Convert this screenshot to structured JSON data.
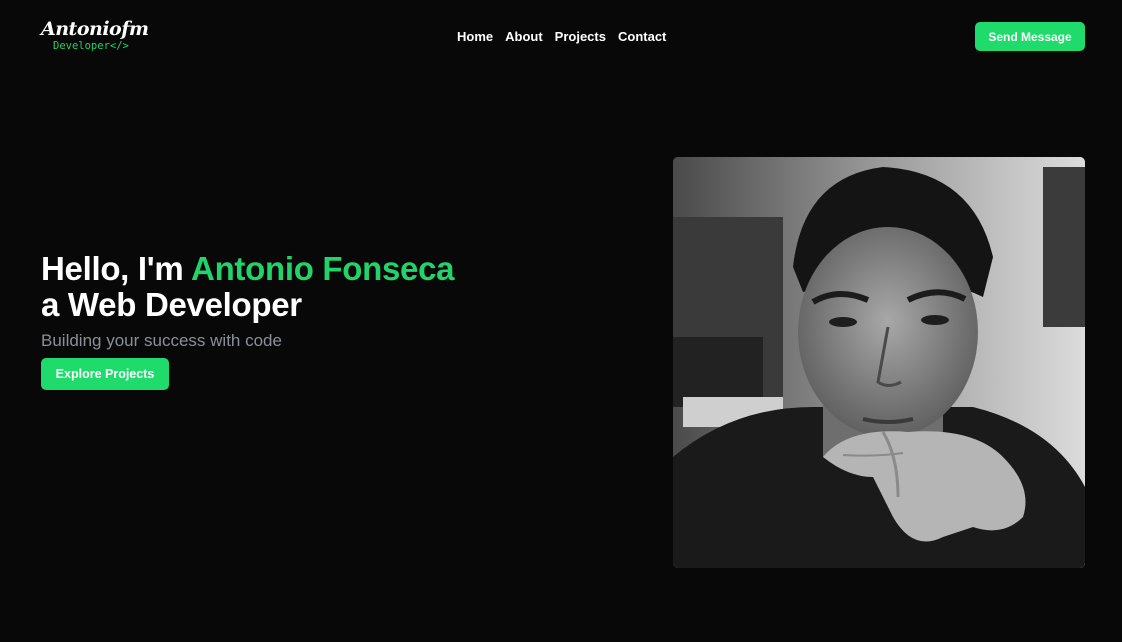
{
  "header": {
    "logo_main": "Antoniofm",
    "logo_sub": "Developer</>",
    "nav": [
      {
        "label": "Home"
      },
      {
        "label": "About"
      },
      {
        "label": "Projects"
      },
      {
        "label": "Contact"
      }
    ],
    "cta_label": "Send Message"
  },
  "hero": {
    "greeting": "Hello, I'm",
    "name": "Antonio Fonseca",
    "role_line": "a Web Developer",
    "subtitle": "Building your success with code",
    "button_label": "Explore Projects"
  },
  "colors": {
    "background": "#080808",
    "accent": "#22d36a",
    "button": "#1fdb6b",
    "subtitle": "#8a8f9a"
  }
}
